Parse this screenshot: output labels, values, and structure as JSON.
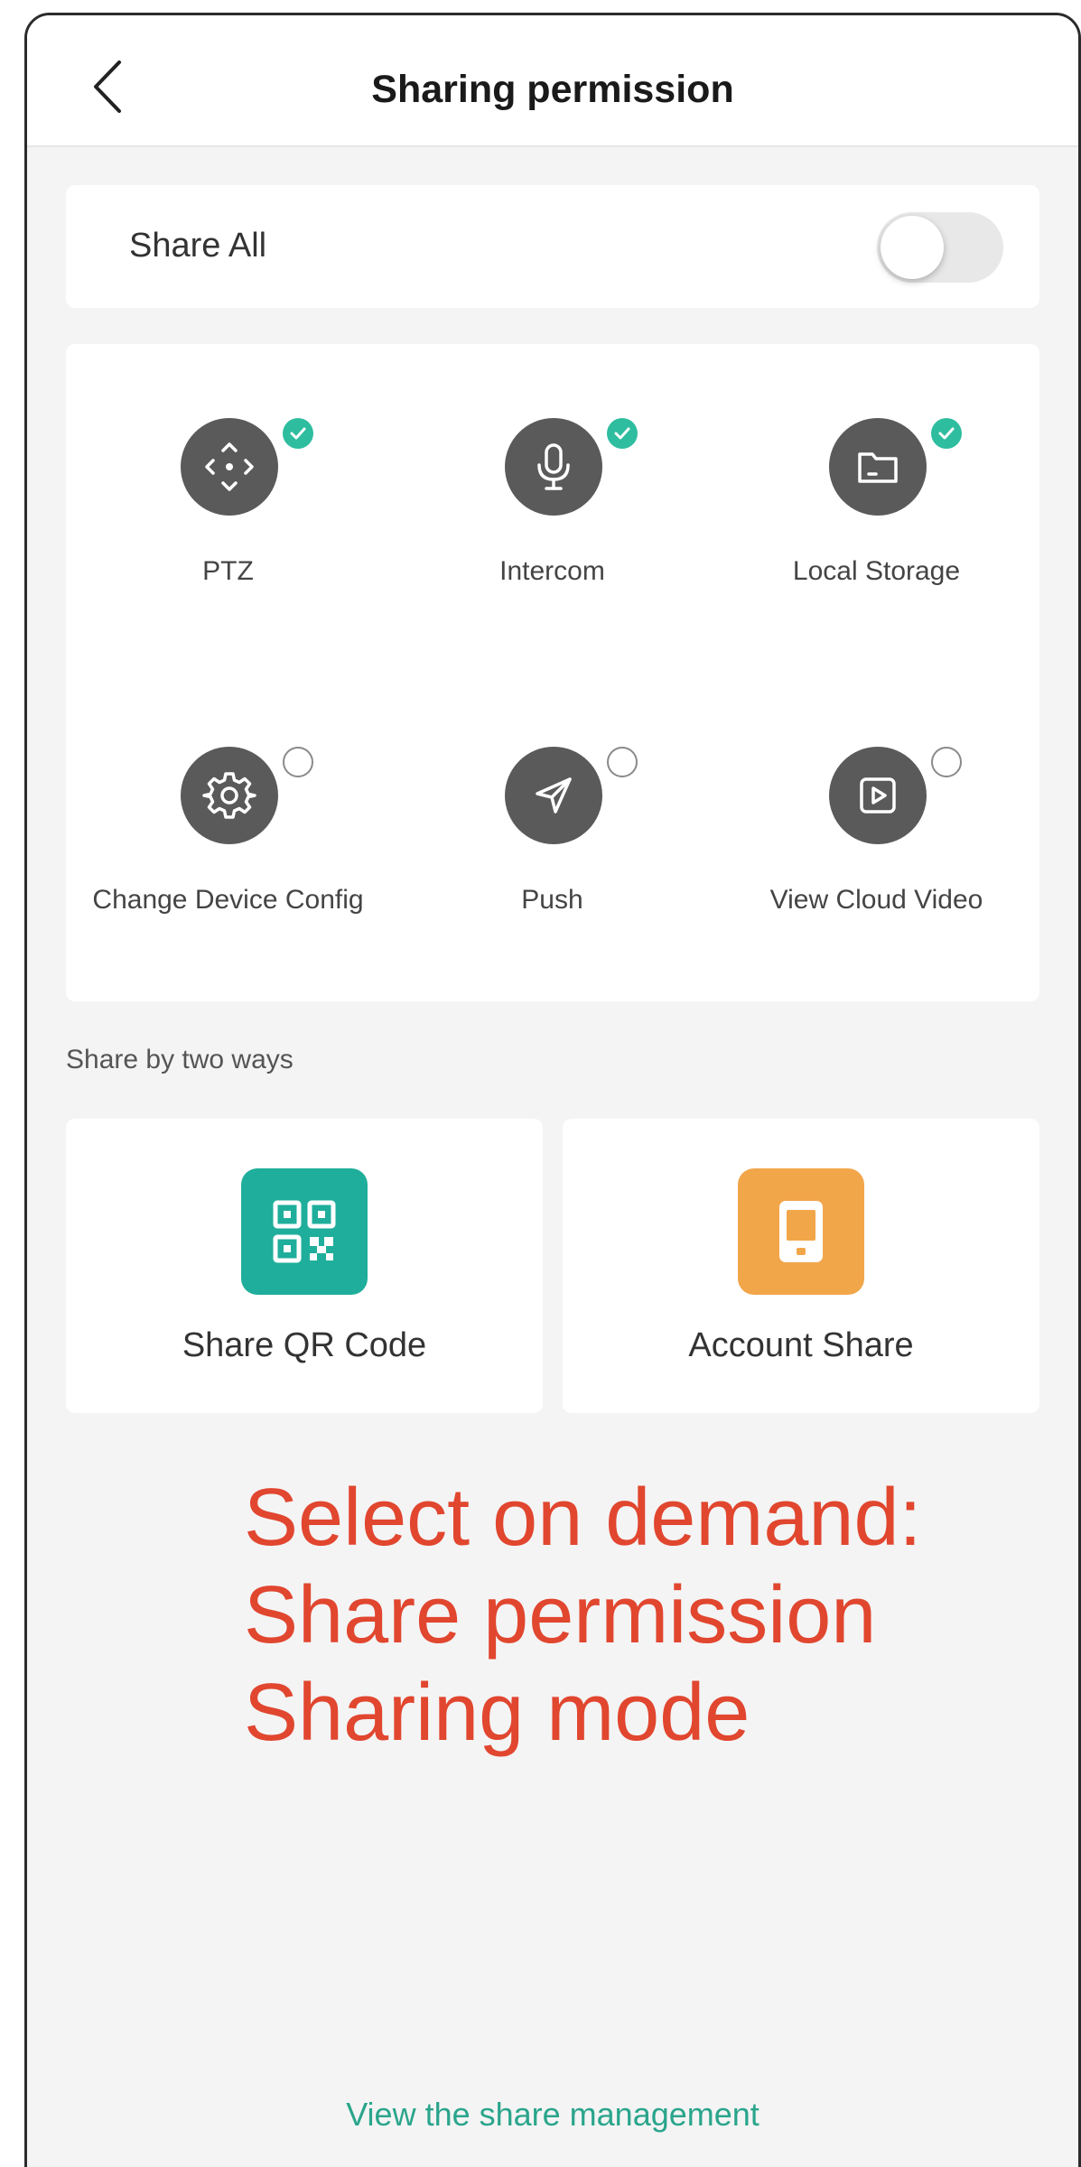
{
  "header": {
    "title": "Sharing permission",
    "back_icon": "chevron-left-icon"
  },
  "share_all": {
    "label": "Share All",
    "toggle_on": false
  },
  "permissions": [
    {
      "label": "PTZ",
      "icon": "direction-pad-icon",
      "checked": true
    },
    {
      "label": "Intercom",
      "icon": "microphone-icon",
      "checked": true
    },
    {
      "label": "Local Storage",
      "icon": "folder-icon",
      "checked": true
    },
    {
      "label": "Change Device Config",
      "icon": "gear-icon",
      "checked": false
    },
    {
      "label": "Push",
      "icon": "send-icon",
      "checked": false
    },
    {
      "label": "View Cloud Video",
      "icon": "play-icon",
      "checked": false
    }
  ],
  "share_section": {
    "label": "Share by two ways",
    "options": [
      {
        "label": "Share QR Code",
        "icon": "qr-code-icon",
        "color": "#1fae9b"
      },
      {
        "label": "Account Share",
        "icon": "phone-icon",
        "color": "#f2a64a"
      }
    ]
  },
  "annotation": {
    "lines": [
      "Select on demand:",
      "Share permission",
      "Sharing mode"
    ],
    "color": "#e1462f"
  },
  "footer": {
    "link": "View the share management"
  },
  "colors": {
    "accent": "#2ebd9f",
    "link": "#2aa58c",
    "icon_bg": "#5a5a5a"
  }
}
